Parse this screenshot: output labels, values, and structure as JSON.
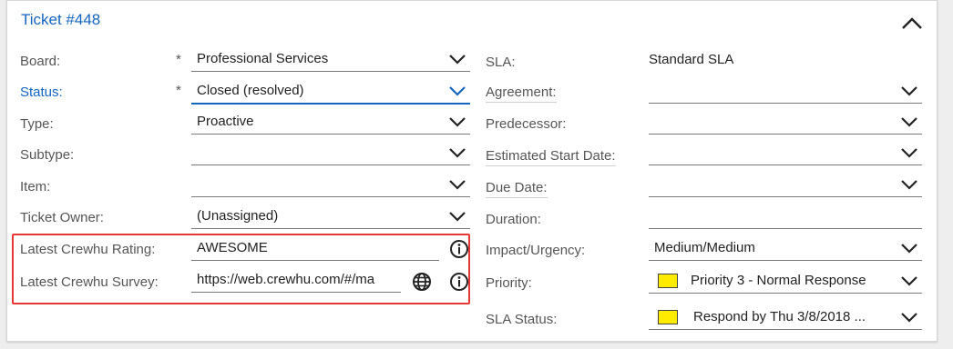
{
  "panel": {
    "title": "Ticket #448"
  },
  "left": {
    "board": {
      "label": "Board:",
      "required": "*",
      "value": "Professional Services"
    },
    "status": {
      "label": "Status:",
      "required": "*",
      "value": "Closed (resolved)"
    },
    "type": {
      "label": "Type:",
      "value": "Proactive"
    },
    "subtype": {
      "label": "Subtype:",
      "value": ""
    },
    "item": {
      "label": "Item:",
      "value": ""
    },
    "owner": {
      "label": "Ticket Owner:",
      "value": "(Unassigned)"
    },
    "crewhu_rating": {
      "label": "Latest Crewhu Rating:",
      "value": "AWESOME"
    },
    "crewhu_survey": {
      "label": "Latest Crewhu Survey:",
      "value": "https://web.crewhu.com/#/ma"
    }
  },
  "right": {
    "sla": {
      "label": "SLA:",
      "value": "Standard SLA"
    },
    "agreement": {
      "label": "Agreement:",
      "value": ""
    },
    "predecessor": {
      "label": "Predecessor:",
      "value": ""
    },
    "estimated_start": {
      "label": "Estimated Start Date:",
      "value": ""
    },
    "due_date": {
      "label": "Due Date:",
      "value": ""
    },
    "duration": {
      "label": "Duration:",
      "value": ""
    },
    "impact": {
      "label": "Impact/Urgency:",
      "value": "Medium/Medium"
    },
    "priority": {
      "label": "Priority:",
      "value": "Priority 3 - Normal Response",
      "color": "#ffeb00"
    },
    "sla_status": {
      "label": "SLA Status:",
      "value": "Respond by Thu 3/8/2018 ...",
      "color": "#ffeb00"
    }
  },
  "colors": {
    "accent": "#1565c0",
    "highlight": "#e53935",
    "priority_swatch": "#ffeb00"
  }
}
